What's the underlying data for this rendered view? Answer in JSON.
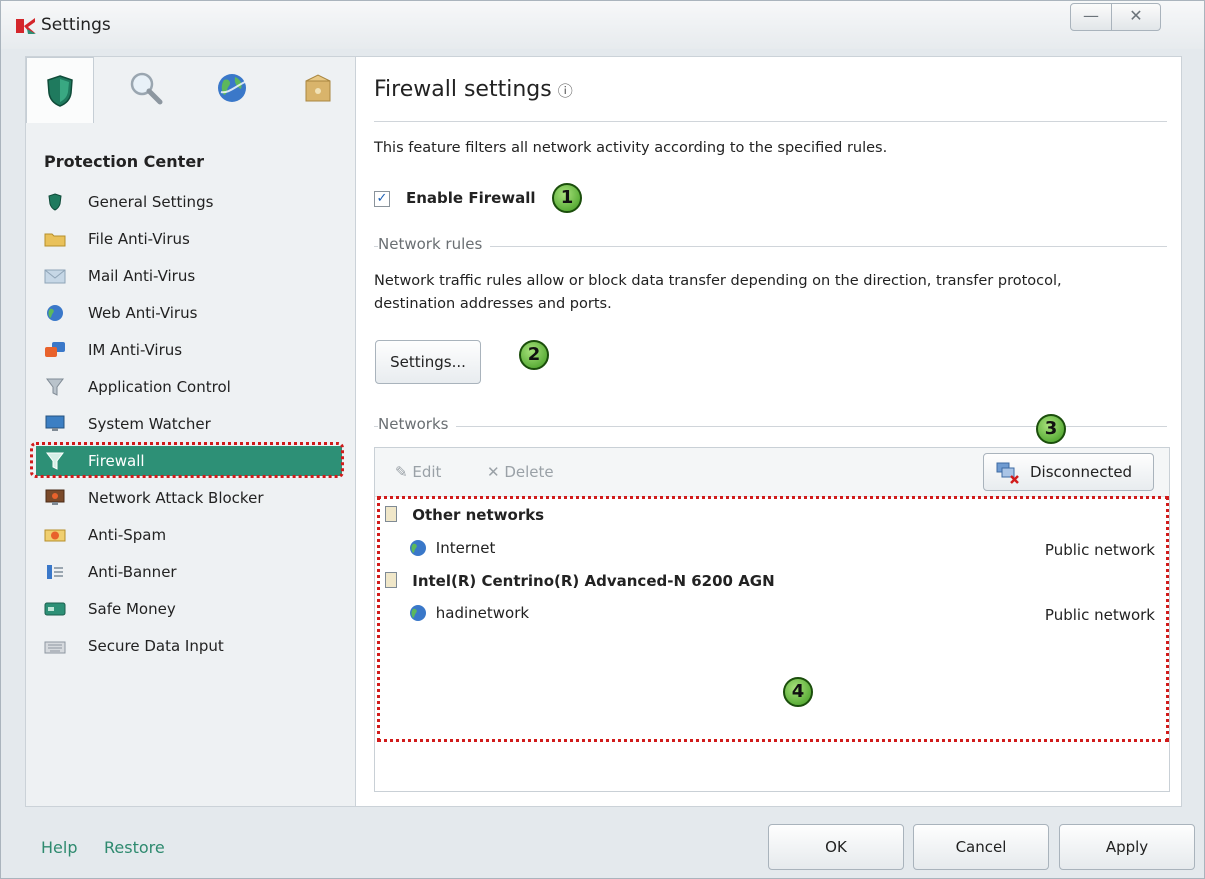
{
  "window": {
    "title": "Settings",
    "minimize_glyph": "—",
    "close_glyph": "✕"
  },
  "tabs": [
    {
      "name": "protection",
      "icon": "shield-icon"
    },
    {
      "name": "scan",
      "icon": "magnifier-icon"
    },
    {
      "name": "update",
      "icon": "globe-icon"
    },
    {
      "name": "advanced",
      "icon": "box-icon"
    }
  ],
  "sidebar": {
    "section_title": "Protection Center",
    "items": [
      {
        "label": "General Settings",
        "icon": "shield-icon"
      },
      {
        "label": "File Anti-Virus",
        "icon": "folder-icon"
      },
      {
        "label": "Mail Anti-Virus",
        "icon": "envelope-icon"
      },
      {
        "label": "Web Anti-Virus",
        "icon": "globe-icon"
      },
      {
        "label": "IM Anti-Virus",
        "icon": "chat-icon"
      },
      {
        "label": "Application Control",
        "icon": "funnel-icon"
      },
      {
        "label": "System Watcher",
        "icon": "monitor-icon"
      },
      {
        "label": "Firewall",
        "icon": "funnel-icon",
        "selected": true
      },
      {
        "label": "Network Attack Blocker",
        "icon": "network-monitor-icon"
      },
      {
        "label": "Anti-Spam",
        "icon": "spam-icon"
      },
      {
        "label": "Anti-Banner",
        "icon": "banner-icon"
      },
      {
        "label": "Safe Money",
        "icon": "card-icon"
      },
      {
        "label": "Secure Data Input",
        "icon": "keyboard-icon"
      }
    ]
  },
  "main": {
    "title": "Firewall settings",
    "info_glyph": "ⓘ",
    "description": "This feature filters all network activity according to the specified rules.",
    "enable_firewall_label": "Enable Firewall",
    "enable_firewall_checked": true,
    "network_rules": {
      "title": "Network rules",
      "description_line1": "Network traffic rules allow or block data transfer depending on the direction, transfer protocol,",
      "description_line2": "destination addresses and ports.",
      "settings_button": "Settings..."
    },
    "networks": {
      "title": "Networks",
      "edit_label": "Edit",
      "delete_label": "Delete",
      "disconnected_label": "Disconnected",
      "groups": [
        {
          "name": "Other networks",
          "entries": [
            {
              "name": "Internet",
              "type": "Public network"
            }
          ]
        },
        {
          "name": "Intel(R) Centrino(R) Advanced-N 6200 AGN",
          "entries": [
            {
              "name": "hadinetwork",
              "type": "Public network"
            }
          ]
        }
      ]
    }
  },
  "badges": [
    "1",
    "2",
    "3",
    "4"
  ],
  "footer": {
    "help": "Help",
    "restore": "Restore",
    "ok": "OK",
    "cancel": "Cancel",
    "apply": "Apply"
  },
  "colors": {
    "accent": "#2d9076",
    "highlight_outline": "#d11b1b",
    "badge": "#5fb832"
  }
}
